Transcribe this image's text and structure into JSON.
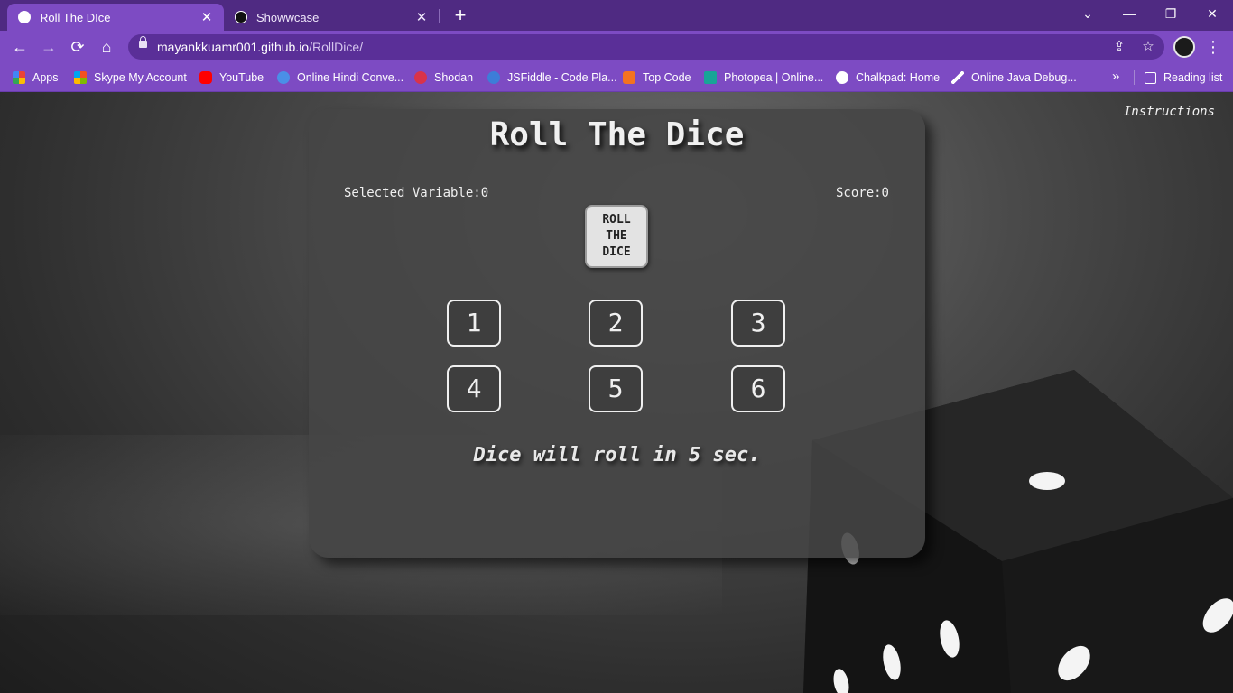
{
  "tabs": [
    {
      "title": "Roll The DIce",
      "close": "✕"
    },
    {
      "title": "Showwcase",
      "close": "✕"
    }
  ],
  "newtab_icon": "+",
  "window_controls": {
    "dropdown": "⌄",
    "minimize": "—",
    "restore": "❐",
    "close": "✕"
  },
  "nav": {
    "back": "←",
    "forward": "→",
    "reload": "⟳",
    "home": "⌂"
  },
  "address": {
    "host": "mayankkuamr001.github.io",
    "path": "/RollDice/"
  },
  "omni_icons": {
    "share": "⇪",
    "star": "☆"
  },
  "menu_icon": "⋮",
  "bookmarks": [
    {
      "label": "Apps",
      "color": "#e94335"
    },
    {
      "label": "Skype My Account",
      "color": "#f25022"
    },
    {
      "label": "YouTube",
      "color": "#ff0000"
    },
    {
      "label": "Online Hindi Conve...",
      "color": "#4a8fe7"
    },
    {
      "label": "Shodan",
      "color": "#d9334a"
    },
    {
      "label": "JSFiddle - Code Pla...",
      "color": "#3d7dd8"
    },
    {
      "label": "Top Code",
      "color": "#f4731f"
    },
    {
      "label": "Photopea | Online...",
      "color": "#18a497"
    },
    {
      "label": "Chalkpad: Home",
      "color": "#ffffff"
    },
    {
      "label": "Online Java Debug...",
      "color": "#ffffff"
    }
  ],
  "bookmarks_more": "»",
  "reading_list": "Reading list",
  "page": {
    "instructions": "Instructions",
    "title": "Roll The Dice",
    "selected_variable": "Selected Variable:0",
    "score": "Score:0",
    "roll_button": [
      "ROLL",
      "THE",
      "DICE"
    ],
    "numbers": [
      "1",
      "2",
      "3",
      "4",
      "5",
      "6"
    ],
    "countdown": "Dice will roll in 5 sec."
  }
}
